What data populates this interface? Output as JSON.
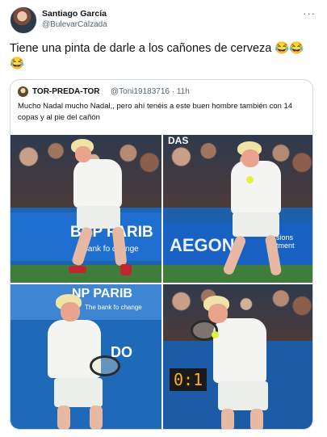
{
  "tweet": {
    "author_name": "Santiago García",
    "author_handle": "@BulevarCalzada",
    "more_label": "···",
    "text": "Tiene una pinta de darle a los cañones de cerveza 😂😂😂"
  },
  "quoted": {
    "author_name": "TOR-PREDA-TOR",
    "meta": "@Toni19183716 · 11h",
    "text": "Mucho Nadal mucho Nadal,, pero ahí tenéis a este buen hombre también con 14 copas y al pie del cañón",
    "images": [
      {
        "icon": "tennis-player-photo",
        "sign_text": "BNP PARIB",
        "sign_sub": "e bank fo change"
      },
      {
        "icon": "tennis-player-photo",
        "sign_text": "AEGON",
        "sign_sub": "sions tment",
        "top_sign": "DAS"
      },
      {
        "icon": "tennis-player-photo",
        "sign_text": "NP PARIB",
        "sign_sub": "The bank fo change",
        "side_text": "DO"
      },
      {
        "icon": "tennis-player-photo",
        "scoreboard": "0:1"
      }
    ]
  },
  "colors": {
    "accent": "#1d9bf0",
    "text": "#0f1419",
    "muted": "#536471",
    "border": "#cfd9de"
  }
}
